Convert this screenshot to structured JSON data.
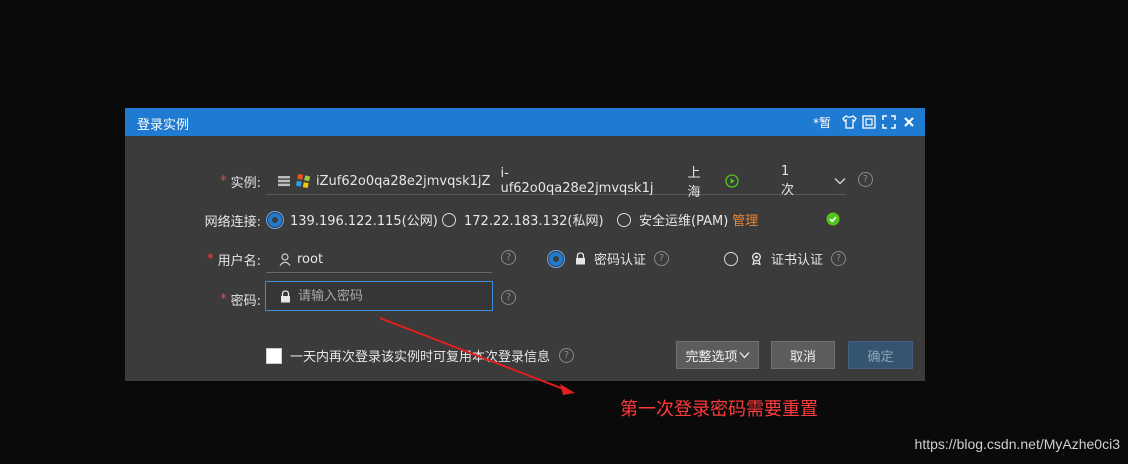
{
  "dialog": {
    "title": "登录实例",
    "toolbar_text": "*暂"
  },
  "instance": {
    "label": "实例:",
    "name": "iZuf62o0qa28e2jmvqsk1jZ",
    "id": "i-uf62o0qa28e2jmvqsk1j",
    "region": "上海",
    "count": "1次"
  },
  "network": {
    "label": "网络连接:",
    "options": [
      {
        "label": "139.196.122.115(公网)",
        "selected": true
      },
      {
        "label": "172.22.183.132(私网)",
        "selected": false
      },
      {
        "label": "安全运维(PAM)",
        "selected": false
      }
    ],
    "manage_link": "管理"
  },
  "username": {
    "label": "用户名:",
    "value": "root"
  },
  "auth": {
    "password_auth": "密码认证",
    "cert_auth": "证书认证",
    "selected": "password_auth"
  },
  "password": {
    "label": "密码:",
    "placeholder": "请输入密码"
  },
  "reuse": {
    "label": "一天内再次登录该实例时可复用本次登录信息",
    "checked": false
  },
  "buttons": {
    "full_options": "完整选项",
    "cancel": "取消",
    "confirm": "确定"
  },
  "annotation": "第一次登录密码需要重置",
  "watermark": "https://blog.csdn.net/MyAzhe0ci3",
  "colors": {
    "title_bar": "#1f7ad1",
    "dialog_bg": "#3b3b3b",
    "required": "#e74c3c",
    "link": "#e8873a",
    "success": "#52c41a",
    "annotation": "#ff3b3b"
  }
}
